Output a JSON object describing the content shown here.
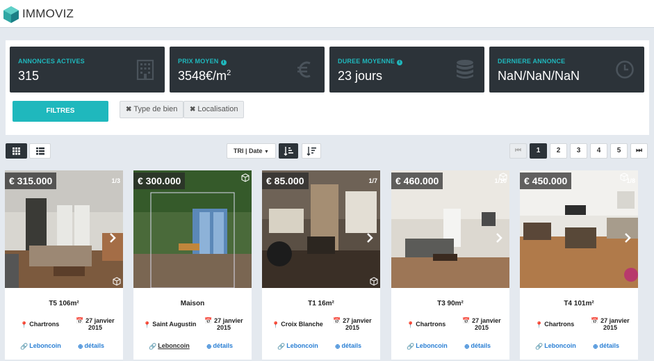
{
  "app": {
    "brand": "IMMOVIZ"
  },
  "stats": [
    {
      "title": "ANNONCES ACTIVES",
      "value": "315",
      "info": false,
      "icon": "building-icon"
    },
    {
      "title": "PRIX MOYEN",
      "value": "3548€/m",
      "sup": "2",
      "info": true,
      "icon": "euro-icon"
    },
    {
      "title": "DUREE MOYENNE",
      "value": "23 jours",
      "info": true,
      "icon": "database-icon"
    },
    {
      "title": "DERNIERE ANNONCE",
      "value": "NaN/NaN/NaN",
      "info": false,
      "icon": "clock-icon"
    }
  ],
  "filters": {
    "button_label": "FILTRES",
    "tags": [
      "Type de bien",
      "Localisation"
    ]
  },
  "toolbar": {
    "sort_label": "TRI | Date"
  },
  "pagination": {
    "pages": [
      "1",
      "2",
      "3",
      "4",
      "5"
    ],
    "current": "1"
  },
  "colors": {
    "accent": "#1fb8bd",
    "dark": "#2c3339",
    "link": "#2a7fd4"
  },
  "listings": [
    {
      "price": "€ 315.000",
      "counter": "1/3",
      "title": "T5 106m²",
      "location": "Chartrons",
      "date_line1": "27 janvier",
      "date_line2": "2015",
      "link_label": "Leboncoin",
      "details_label": "détails"
    },
    {
      "price": "€ 300.000",
      "counter": "",
      "title": "Maison",
      "location": "Saint Augustin",
      "date_line1": "27 janvier",
      "date_line2": "2015",
      "link_label": "Leboncoin",
      "details_label": "détails"
    },
    {
      "price": "€ 85.000",
      "counter": "1/7",
      "title": "T1 16m²",
      "location": "Croix Blanche",
      "date_line1": "27 janvier",
      "date_line2": "2015",
      "link_label": "Leboncoin",
      "details_label": "détails"
    },
    {
      "price": "€ 460.000",
      "counter": "1/10",
      "title": "T3 90m²",
      "location": "Chartrons",
      "date_line1": "27 janvier",
      "date_line2": "2015",
      "link_label": "Leboncoin",
      "details_label": "détails"
    },
    {
      "price": "€ 450.000",
      "counter": "1/8",
      "title": "T4 101m²",
      "location": "Chartrons",
      "date_line1": "27 janvier",
      "date_line2": "2015",
      "link_label": "Leboncoin",
      "details_label": "détails"
    }
  ]
}
